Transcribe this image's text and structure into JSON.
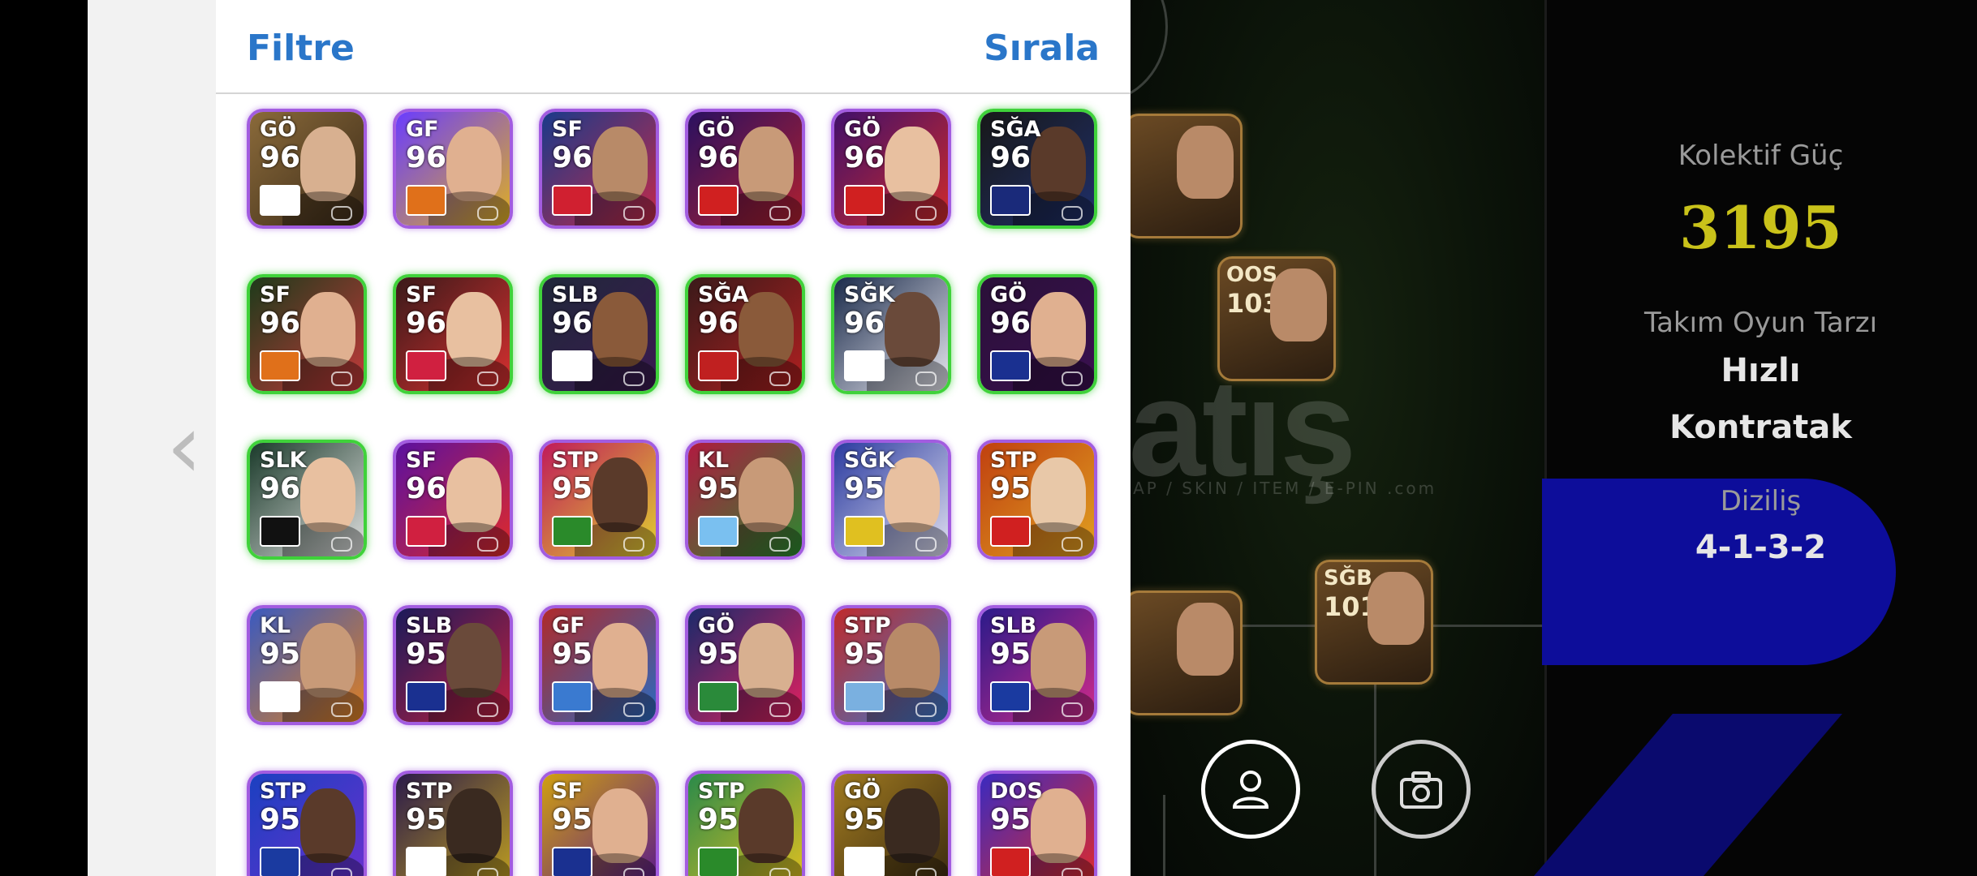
{
  "panel": {
    "filter_label": "Filtre",
    "sort_label": "Sırala"
  },
  "cards": [
    {
      "pos": "GÖ",
      "rating": "96",
      "tier": "purple",
      "club": "real-madrid-crest"
    },
    {
      "pos": "GF",
      "rating": "96",
      "tier": "purple",
      "club": "atletico-crest"
    },
    {
      "pos": "SF",
      "rating": "96",
      "tier": "purple",
      "club": "portugal-flag"
    },
    {
      "pos": "GÖ",
      "rating": "96",
      "tier": "purple",
      "club": "arsenal-crest"
    },
    {
      "pos": "GÖ",
      "rating": "96",
      "tier": "purple",
      "club": "arsenal-crest"
    },
    {
      "pos": "SĞA",
      "rating": "96",
      "tier": "green",
      "club": "psg-crest"
    },
    {
      "pos": "SF",
      "rating": "96",
      "tier": "green",
      "club": "atletico-crest"
    },
    {
      "pos": "SF",
      "rating": "96",
      "tier": "green",
      "club": "bayern-crest"
    },
    {
      "pos": "SLB",
      "rating": "96",
      "tier": "green",
      "club": "england-flag"
    },
    {
      "pos": "SĞA",
      "rating": "96",
      "tier": "green",
      "club": "egypt-flag"
    },
    {
      "pos": "SĞK",
      "rating": "96",
      "tier": "green",
      "club": "england-flag"
    },
    {
      "pos": "GÖ",
      "rating": "96",
      "tier": "green",
      "club": "barcelona-crest"
    },
    {
      "pos": "SLK",
      "rating": "96",
      "tier": "green",
      "club": "germany-flag"
    },
    {
      "pos": "SF",
      "rating": "96",
      "tier": "purple",
      "club": "bayern-crest"
    },
    {
      "pos": "STP",
      "rating": "95",
      "tier": "purple",
      "club": "brazil-flag"
    },
    {
      "pos": "KL",
      "rating": "95",
      "tier": "purple",
      "club": "argentina-flag"
    },
    {
      "pos": "SĞK",
      "rating": "95",
      "tier": "purple",
      "club": "club-crest"
    },
    {
      "pos": "STP",
      "rating": "95",
      "tier": "purple",
      "club": "man-utd-crest"
    },
    {
      "pos": "KL",
      "rating": "95",
      "tier": "purple",
      "club": "slovenia-flag"
    },
    {
      "pos": "SLB",
      "rating": "95",
      "tier": "purple",
      "club": "barcelona-crest"
    },
    {
      "pos": "GF",
      "rating": "95",
      "tier": "purple",
      "club": "club-crest"
    },
    {
      "pos": "GÖ",
      "rating": "95",
      "tier": "purple",
      "club": "hungary-flag"
    },
    {
      "pos": "STP",
      "rating": "95",
      "tier": "purple",
      "club": "uruguay-flag"
    },
    {
      "pos": "SLB",
      "rating": "95",
      "tier": "purple",
      "club": "france-flag"
    },
    {
      "pos": "STP",
      "rating": "95",
      "tier": "purple",
      "club": "france-flag"
    },
    {
      "pos": "STP",
      "rating": "95",
      "tier": "purple",
      "club": "real-madrid-crest"
    },
    {
      "pos": "SF",
      "rating": "95",
      "tier": "purple",
      "club": "barcelona-crest"
    },
    {
      "pos": "STP",
      "rating": "95",
      "tier": "purple",
      "club": "brazil-flag"
    },
    {
      "pos": "GÖ",
      "rating": "95",
      "tier": "purple",
      "club": "real-madrid-crest"
    },
    {
      "pos": "DOS",
      "rating": "95",
      "tier": "purple",
      "club": "arsenal-crest"
    }
  ],
  "field": {
    "players": [
      {
        "pos": "OOS",
        "rating": "103"
      },
      {
        "pos": "SĞB",
        "rating": "101"
      }
    ],
    "watermark": "satış",
    "watermark_sub": "SAP / SKIN / ITEM / E-PIN .com"
  },
  "stats": {
    "power_label": "Kolektif Güç",
    "power_value": "3195",
    "style_label": "Takım Oyun Tarzı",
    "style_value_1": "Hızlı",
    "style_value_2": "Kontratak",
    "formation_label": "Diziliş",
    "formation_value": "4-1-3-2"
  },
  "icons": {
    "profile": "person-icon",
    "camera": "camera-icon",
    "back": "chevron-left-icon"
  },
  "colors": {
    "accent_blue": "#2a76c9",
    "power_yellow": "#c9c21a",
    "tier_purple": "#a25ce0",
    "tier_green": "#3fd23a"
  }
}
